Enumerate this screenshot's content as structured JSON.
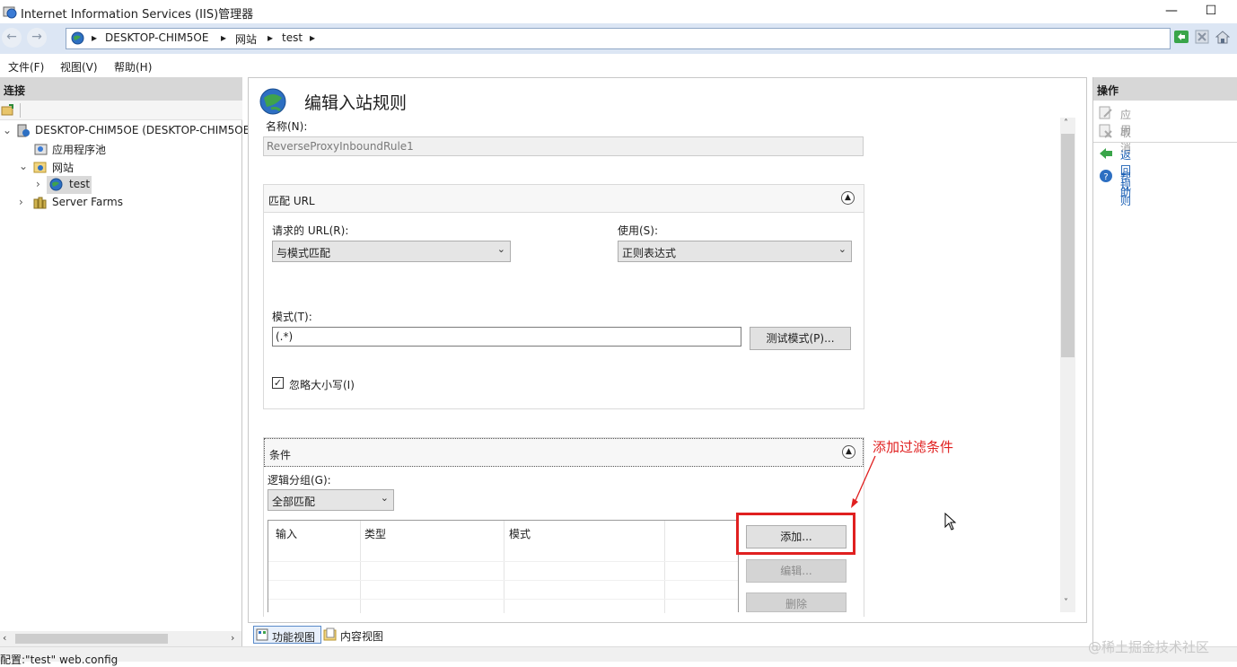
{
  "window": {
    "title": "Internet Information Services (IIS)管理器"
  },
  "address": {
    "crumbs": [
      "DESKTOP-CHIM5OE",
      "网站",
      "test"
    ]
  },
  "menu": [
    "文件(F)",
    "视图(V)",
    "帮助(H)"
  ],
  "connections": {
    "header": "连接",
    "tree": [
      {
        "label": "DESKTOP-CHIM5OE (DESKTOP-CHIM5OE",
        "icon": "server-icon"
      },
      {
        "label": "应用程序池",
        "icon": "app-pool-icon"
      },
      {
        "label": "网站",
        "icon": "sites-folder-icon"
      },
      {
        "label": "test",
        "icon": "globe-icon"
      },
      {
        "label": "Server Farms",
        "icon": "server-farm-icon"
      }
    ]
  },
  "editor": {
    "title": "编辑入站规则",
    "name_label": "名称(N):",
    "name_value": "ReverseProxyInboundRule1",
    "match_url": {
      "header": "匹配 URL",
      "requested_url_label": "请求的 URL(R):",
      "requested_url_value": "与模式匹配",
      "using_label": "使用(S):",
      "using_value": "正则表达式",
      "pattern_label": "模式(T):",
      "pattern_value": "(.*)",
      "test_button": "测试模式(P)...",
      "ignore_case_label": "忽略大小写(I)",
      "ignore_case_checked": true
    },
    "conditions": {
      "header": "条件",
      "logical_grouping_label": "逻辑分组(G):",
      "logical_grouping_value": "全部匹配",
      "columns": [
        "输入",
        "类型",
        "模式"
      ],
      "add_button": "添加...",
      "edit_button": "编辑...",
      "remove_button": "删除"
    },
    "annotation": "添加过滤条件"
  },
  "actions": {
    "header": "操作",
    "items": [
      {
        "label": "应用",
        "enabled": false
      },
      {
        "label": "取消",
        "enabled": false
      },
      {
        "label": "返回规则",
        "enabled": true
      },
      {
        "label": "帮助",
        "enabled": true
      }
    ]
  },
  "view_tabs": [
    "功能视图",
    "内容视图"
  ],
  "status": "配置:\"test\" web.config",
  "watermark": "@稀土掘金技术社区",
  "colors": {
    "accent": "#e02020",
    "link": "#1a5fb4",
    "header_bg": "#d7d7d7"
  }
}
